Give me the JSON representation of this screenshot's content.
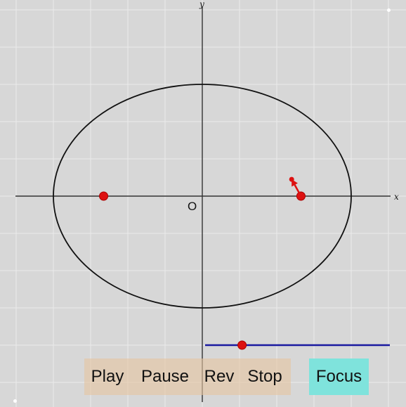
{
  "axes": {
    "x_label": "x",
    "y_label": "y",
    "origin_label": "O",
    "xlim": [
      -5.4,
      5.4
    ],
    "ylim": [
      -5.4,
      5.4
    ],
    "grid": true
  },
  "ellipse": {
    "a": 4,
    "b": 3,
    "center": [
      0,
      0
    ]
  },
  "foci": [
    [
      -2.65,
      0
    ],
    [
      2.65,
      0
    ]
  ],
  "moving_point": {
    "position": [
      2.4,
      0.45
    ]
  },
  "speed_slider": {
    "value": 0.2
  },
  "buttons": {
    "play": "Play",
    "pause": "Pause",
    "rev": "Rev",
    "stop": "Stop",
    "focus": "Focus"
  },
  "colors": {
    "background": "#d7d7d7",
    "grid": "#ebebeb",
    "ellipse": "#111111",
    "point": "#dd1111",
    "slider_line": "#1a1aa0",
    "control_button": "#e6c4a0",
    "focus_button": "#7fe3dc"
  }
}
